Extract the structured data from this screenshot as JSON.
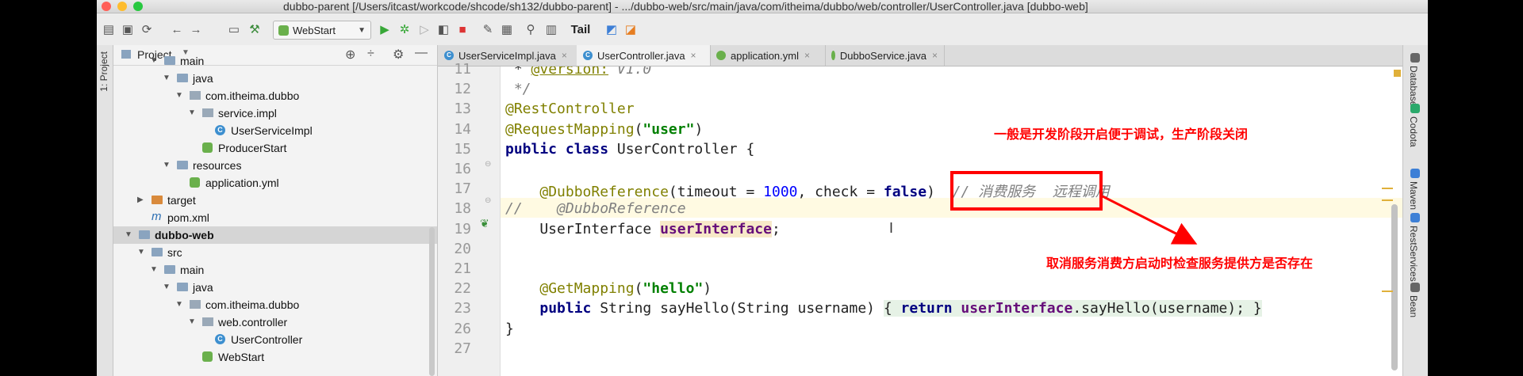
{
  "window": {
    "title": "dubbo-parent [/Users/itcast/workcode/shcode/sh132/dubbo-parent] - .../dubbo-web/src/main/java/com/itheima/dubbo/web/controller/UserController.java [dubbo-web]",
    "traffic_colors": {
      "close": "#ff5f57",
      "minimize": "#febc2e",
      "zoom": "#28c840"
    }
  },
  "toolbar": {
    "run_config": "WebStart",
    "tail_label": "Tail"
  },
  "left_strip": {
    "label": "1: Project"
  },
  "project": {
    "header": "Project",
    "tree": [
      {
        "label": "main",
        "indent": 2,
        "icon": "folder",
        "arrow": "▼"
      },
      {
        "label": "java",
        "indent": 3,
        "icon": "folder",
        "arrow": "▼"
      },
      {
        "label": "com.itheima.dubbo",
        "indent": 4,
        "icon": "package",
        "arrow": "▼"
      },
      {
        "label": "service.impl",
        "indent": 5,
        "icon": "package",
        "arrow": "▼"
      },
      {
        "label": "UserServiceImpl",
        "indent": 6,
        "icon": "class",
        "arrow": ""
      },
      {
        "label": "ProducerStart",
        "indent": 5,
        "icon": "spring-class",
        "arrow": ""
      },
      {
        "label": "resources",
        "indent": 3,
        "icon": "folder",
        "arrow": "▼"
      },
      {
        "label": "application.yml",
        "indent": 4,
        "icon": "yml",
        "arrow": ""
      },
      {
        "label": "target",
        "indent": 1,
        "icon": "folder-orange",
        "arrow": "▶"
      },
      {
        "label": "pom.xml",
        "indent": 1,
        "icon": "maven",
        "arrow": ""
      },
      {
        "label": "dubbo-web",
        "indent": 0,
        "icon": "folder",
        "arrow": "▼",
        "bold": true,
        "selected": true
      },
      {
        "label": "src",
        "indent": 1,
        "icon": "folder",
        "arrow": "▼"
      },
      {
        "label": "main",
        "indent": 2,
        "icon": "folder",
        "arrow": "▼"
      },
      {
        "label": "java",
        "indent": 3,
        "icon": "folder",
        "arrow": "▼"
      },
      {
        "label": "com.itheima.dubbo",
        "indent": 4,
        "icon": "package",
        "arrow": "▼"
      },
      {
        "label": "web.controller",
        "indent": 5,
        "icon": "package",
        "arrow": "▼"
      },
      {
        "label": "UserController",
        "indent": 6,
        "icon": "class",
        "arrow": ""
      },
      {
        "label": "WebStart",
        "indent": 5,
        "icon": "spring-class",
        "arrow": ""
      }
    ]
  },
  "tabs": [
    {
      "label": "UserServiceImpl.java",
      "icon": "class",
      "active": false
    },
    {
      "label": "UserController.java",
      "icon": "class",
      "active": true
    },
    {
      "label": "application.yml",
      "icon": "yml",
      "active": false
    },
    {
      "label": "DubboService.java",
      "icon": "annotation",
      "active": false
    }
  ],
  "code": {
    "lines": [
      {
        "n": "11",
        "html": " * <span class=\"ann\"><u>@version:</u></span> <span class=\"cmt\">V1.0</span>"
      },
      {
        "n": "12",
        "html": " <span class=\"cmt\">*/</span>"
      },
      {
        "n": "13",
        "html": "<span class=\"ann\">@RestController</span>"
      },
      {
        "n": "14",
        "html": "<span class=\"ann\">@RequestMapping</span>(<span class=\"str\">\"user\"</span>)"
      },
      {
        "n": "15",
        "html": "<span class=\"kw\">public class</span> UserController {"
      },
      {
        "n": "16",
        "html": ""
      },
      {
        "n": "17",
        "html": "    <span class=\"ann\">@DubboReference</span>(timeout = <span class=\"num\">1000</span>, check = <span class=\"kw\">false</span>)  <span class=\"cmt\">// 消费服务  远程调用</span>"
      },
      {
        "n": "18",
        "html": "<span class=\"cmt\">//    @DubboReference</span>"
      },
      {
        "n": "19",
        "html": "    UserInterface <span class=\"fld hl\">userInterface</span>;"
      },
      {
        "n": "20",
        "html": ""
      },
      {
        "n": "21",
        "html": ""
      },
      {
        "n": "22",
        "html": "    <span class=\"ann\">@GetMapping</span>(<span class=\"str\">\"hello\"</span>)"
      },
      {
        "n": "23",
        "html": "    <span class=\"kw\">public</span> String sayHello(String username) <span class=\"fold-bg\">{ <span class=\"kw\">return</span> <span class=\"fld\">userInterface</span>.sayHello(username); }</span>"
      },
      {
        "n": "26",
        "html": "}"
      },
      {
        "n": "27",
        "html": ""
      }
    ]
  },
  "annotations": {
    "top_note": "一般是开发阶段开启便于调试，生产阶段关闭",
    "bottom_note": "取消服务消费方启动时检查服务提供方是否存在",
    "color": "#ff0000"
  },
  "right_strip": [
    "Database",
    "Codota",
    "Maven",
    "RestServices",
    "Bean"
  ]
}
